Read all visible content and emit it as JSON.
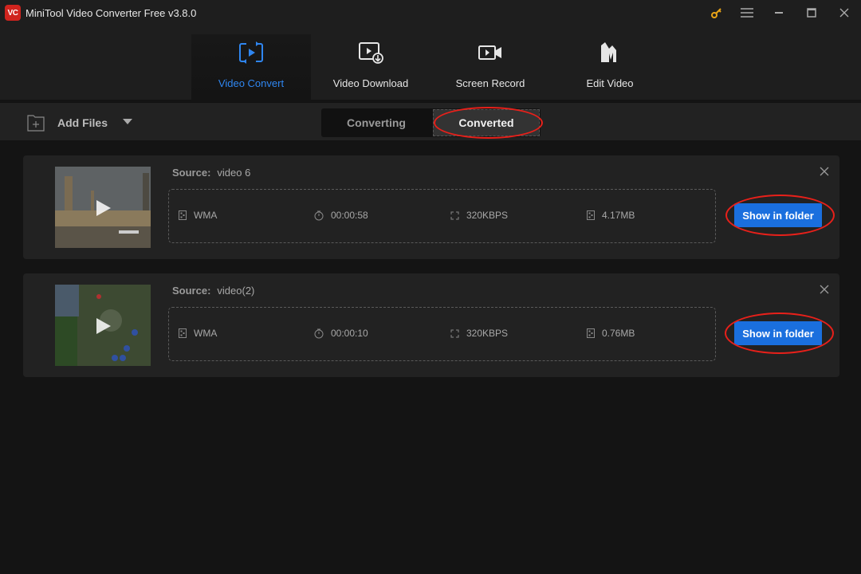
{
  "app": {
    "logo_text": "VC",
    "title": "MiniTool Video Converter Free v3.8.0"
  },
  "window_controls": [
    {
      "name": "key-icon",
      "color": "#e8a317"
    },
    {
      "name": "menu-icon"
    },
    {
      "name": "minimize-icon"
    },
    {
      "name": "maximize-icon"
    },
    {
      "name": "close-icon"
    }
  ],
  "nav": {
    "tabs": [
      {
        "label": "Video Convert",
        "icon": "convert-icon",
        "active": true
      },
      {
        "label": "Video Download",
        "icon": "download-icon",
        "active": false
      },
      {
        "label": "Screen Record",
        "icon": "record-icon",
        "active": false
      },
      {
        "label": "Edit Video",
        "icon": "edit-video-icon",
        "active": false
      }
    ],
    "active_color": "#2f86f0"
  },
  "toolbar": {
    "add_files_label": "Add Files",
    "segments": [
      {
        "label": "Converting",
        "active": false
      },
      {
        "label": "Converted",
        "active": true
      }
    ]
  },
  "items": [
    {
      "source_label": "Source:",
      "source_name": "video 6",
      "format": "WMA",
      "duration": "00:00:58",
      "bitrate": "320KBPS",
      "size": "4.17MB",
      "action_label": "Show in folder"
    },
    {
      "source_label": "Source:",
      "source_name": "video(2)",
      "format": "WMA",
      "duration": "00:00:10",
      "bitrate": "320KBPS",
      "size": "0.76MB",
      "action_label": "Show in folder"
    }
  ],
  "colors": {
    "accent_blue": "#1a6fde",
    "annotation_red": "#e8201a"
  }
}
